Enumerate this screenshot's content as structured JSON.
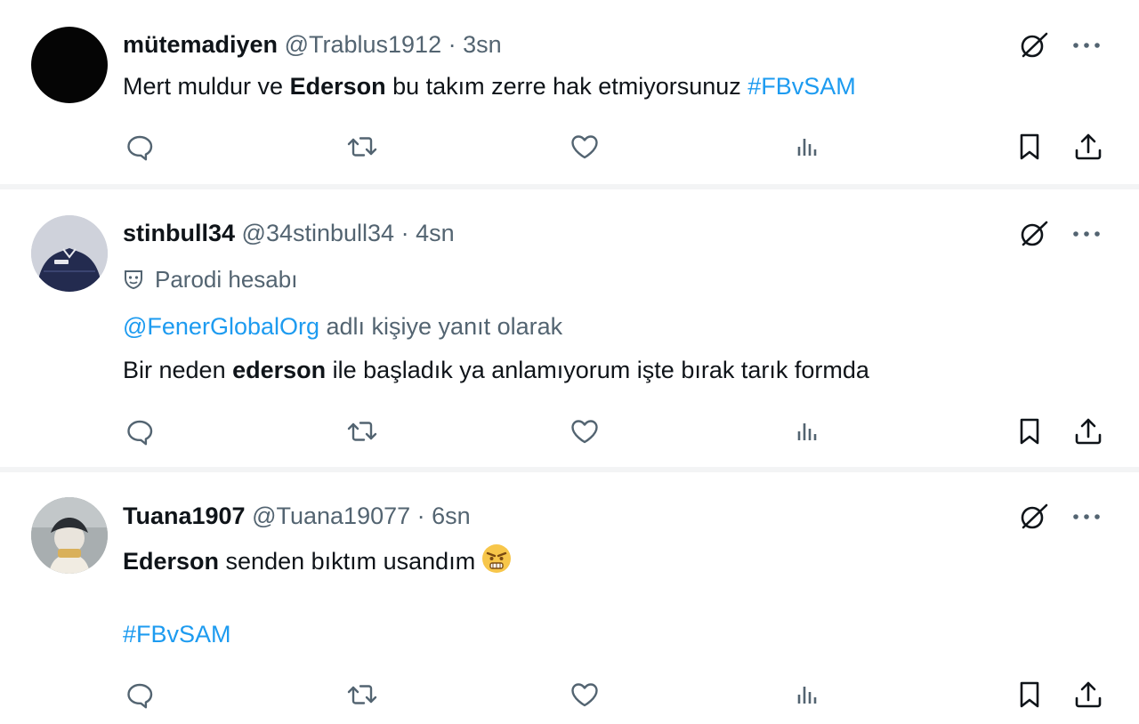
{
  "tweets": [
    {
      "display_name": "mütemadiyen",
      "handle": "@Trablus1912",
      "time": "3sn",
      "body_prefix": "Mert muldur ve ",
      "body_bold": "Ederson",
      "body_middle": " bu takım zerre hak etmiyorsunuz ",
      "hashtag": "#FBvSAM"
    },
    {
      "display_name": "stinbull34",
      "handle": "@34stinbull34",
      "time": "4sn",
      "account_label": "Parodi hesabı",
      "reply_mention": "@FenerGlobalOrg",
      "reply_suffix": " adlı kişiye yanıt olarak",
      "body_prefix": "Bir neden ",
      "body_bold": "ederson",
      "body_suffix": " ile başladık ya anlamıyorum işte bırak tarık formda"
    },
    {
      "display_name": "Tuana1907",
      "handle": "@Tuana19077",
      "time": "6sn",
      "body_bold": "Ederson",
      "body_suffix": " senden bıktım usandım",
      "emoji": "angry-face-emoji",
      "hashtag": "#FBvSAM"
    }
  ],
  "separator": " · ",
  "colors": {
    "text": "#0f1419",
    "secondary": "#536471",
    "link": "#1d9bf0",
    "divider": "#f3f4f5"
  },
  "icons": {
    "top": [
      "grok-icon",
      "more-icon"
    ],
    "actions": [
      "reply-icon",
      "retweet-icon",
      "like-icon",
      "views-icon",
      "bookmark-icon",
      "share-icon"
    ]
  }
}
